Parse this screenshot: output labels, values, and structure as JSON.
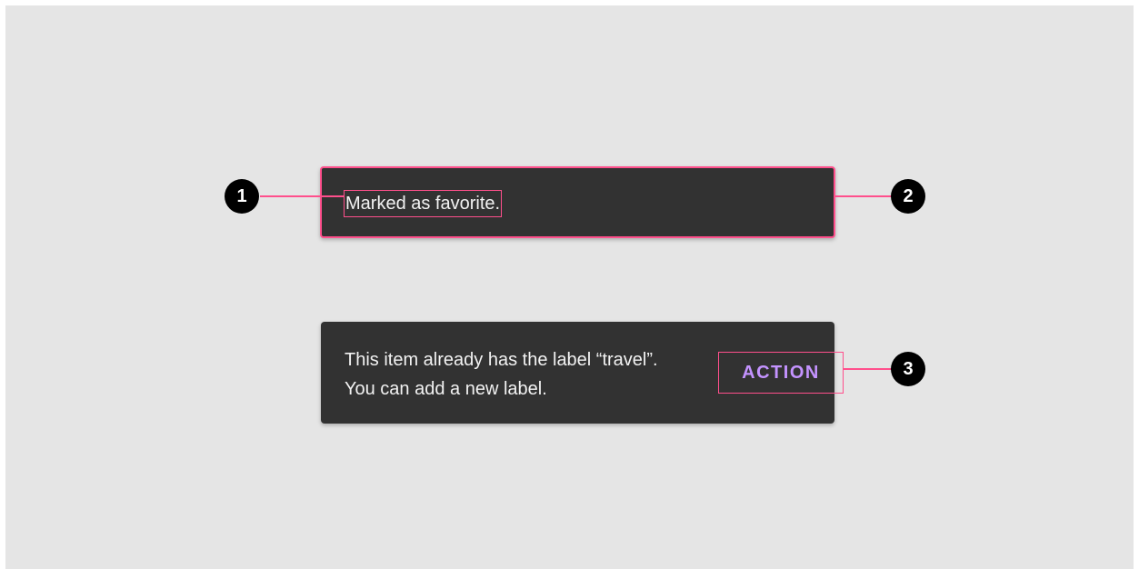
{
  "snackbar_single": {
    "message": "Marked as favorite."
  },
  "snackbar_with_action": {
    "message": "This item already has the label “travel”. You can add a new label.",
    "action_label": "ACTION"
  },
  "callouts": {
    "one": "1",
    "two": "2",
    "three": "3"
  },
  "colors": {
    "background": "#e5e5e5",
    "snackbar": "#323232",
    "text": "#f2f2f2",
    "action": "#c493ff",
    "highlight": "#ff4f8c",
    "marker": "#000000"
  }
}
